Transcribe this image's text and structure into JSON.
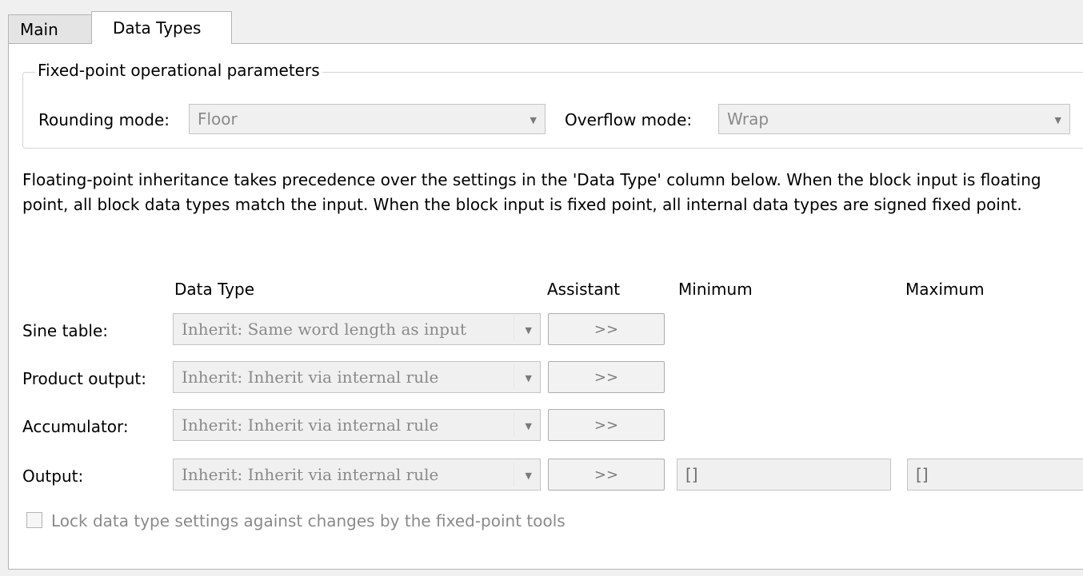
{
  "tabs": [
    {
      "label": "Main",
      "active": false
    },
    {
      "label": "Data Types",
      "active": true
    }
  ],
  "fixed_point": {
    "legend": "Fixed-point operational parameters",
    "rounding_label": "Rounding mode:",
    "rounding_value": "Floor",
    "overflow_label": "Overflow mode:",
    "overflow_value": "Wrap"
  },
  "description": "Floating-point inheritance takes precedence over the settings in the 'Data Type' column below. When the block input is floating point, all block data types match the input. When the block input is fixed point, all internal data types are signed fixed point.",
  "columns": {
    "data_type": "Data Type",
    "assistant": "Assistant",
    "minimum": "Minimum",
    "maximum": "Maximum"
  },
  "rows": [
    {
      "label": "Sine table:",
      "data_type": "Inherit: Same word length as input",
      "assistant": ">>"
    },
    {
      "label": "Product output:",
      "data_type": "Inherit: Inherit via internal rule",
      "assistant": ">>"
    },
    {
      "label": "Accumulator:",
      "data_type": "Inherit: Inherit via internal rule",
      "assistant": ">>"
    },
    {
      "label": "Output:",
      "data_type": "Inherit: Inherit via internal rule",
      "assistant": ">>",
      "minimum": "[]",
      "maximum": "[]"
    }
  ],
  "lock": {
    "label": "Lock data type settings against changes by the fixed-point tools",
    "checked": false
  },
  "icons": {
    "dropdown": "chevron-down-icon"
  }
}
